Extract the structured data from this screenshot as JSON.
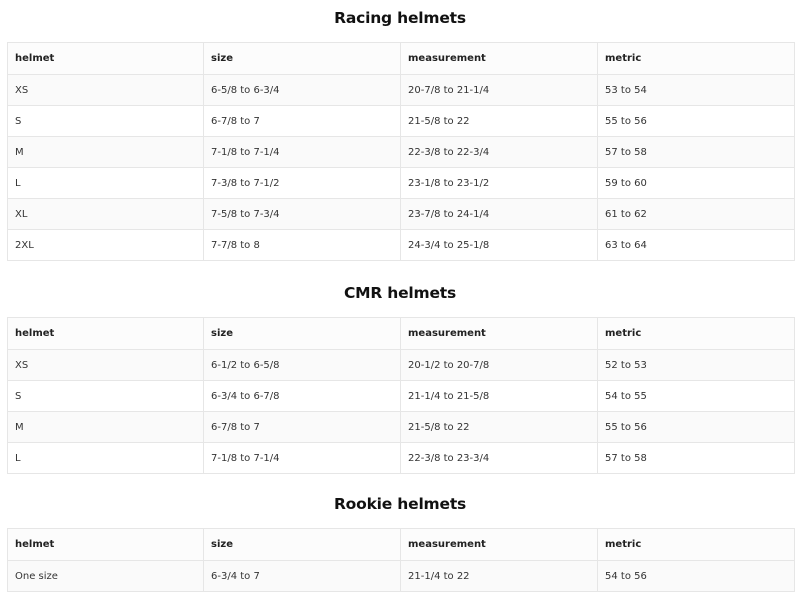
{
  "sections": [
    {
      "id": "racing",
      "title": "Racing helmets",
      "headers": [
        "helmet",
        "size",
        "measurement",
        "metric"
      ],
      "rows": [
        [
          "XS",
          "6-5/8 to 6-3/4",
          "20-7/8 to 21-1/4",
          "53 to 54"
        ],
        [
          "S",
          "6-7/8 to 7",
          "21-5/8 to 22",
          "55 to 56"
        ],
        [
          "M",
          "7-1/8 to 7-1/4",
          "22-3/8 to 22-3/4",
          "57 to 58"
        ],
        [
          "L",
          "7-3/8 to 7-1/2",
          "23-1/8 to 23-1/2",
          "59 to 60"
        ],
        [
          "XL",
          "7-5/8 to 7-3/4",
          "23-7/8 to 24-1/4",
          "61 to 62"
        ],
        [
          "2XL",
          "7-7/8 to 8",
          "24-3/4 to 25-1/8",
          "63 to 64"
        ]
      ]
    },
    {
      "id": "cmr",
      "title": "CMR helmets",
      "headers": [
        "helmet",
        "size",
        "measurement",
        "metric"
      ],
      "rows": [
        [
          "XS",
          "6-1/2 to 6-5/8",
          "20-1/2 to 20-7/8",
          "52 to 53"
        ],
        [
          "S",
          "6-3/4 to 6-7/8",
          "21-1/4 to 21-5/8",
          "54 to 55"
        ],
        [
          "M",
          "6-7/8 to 7",
          "21-5/8 to 22",
          "55 to 56"
        ],
        [
          "L",
          "7-1/8 to 7-1/4",
          "22-3/8 to 23-3/4",
          "57 to 58"
        ]
      ]
    },
    {
      "id": "rookie",
      "title": "Rookie helmets",
      "headers": [
        "helmet",
        "size",
        "measurement",
        "metric"
      ],
      "rows": [
        [
          "One size",
          "6-3/4 to 7",
          "21-1/4 to 22",
          "54 to 56"
        ]
      ]
    }
  ]
}
